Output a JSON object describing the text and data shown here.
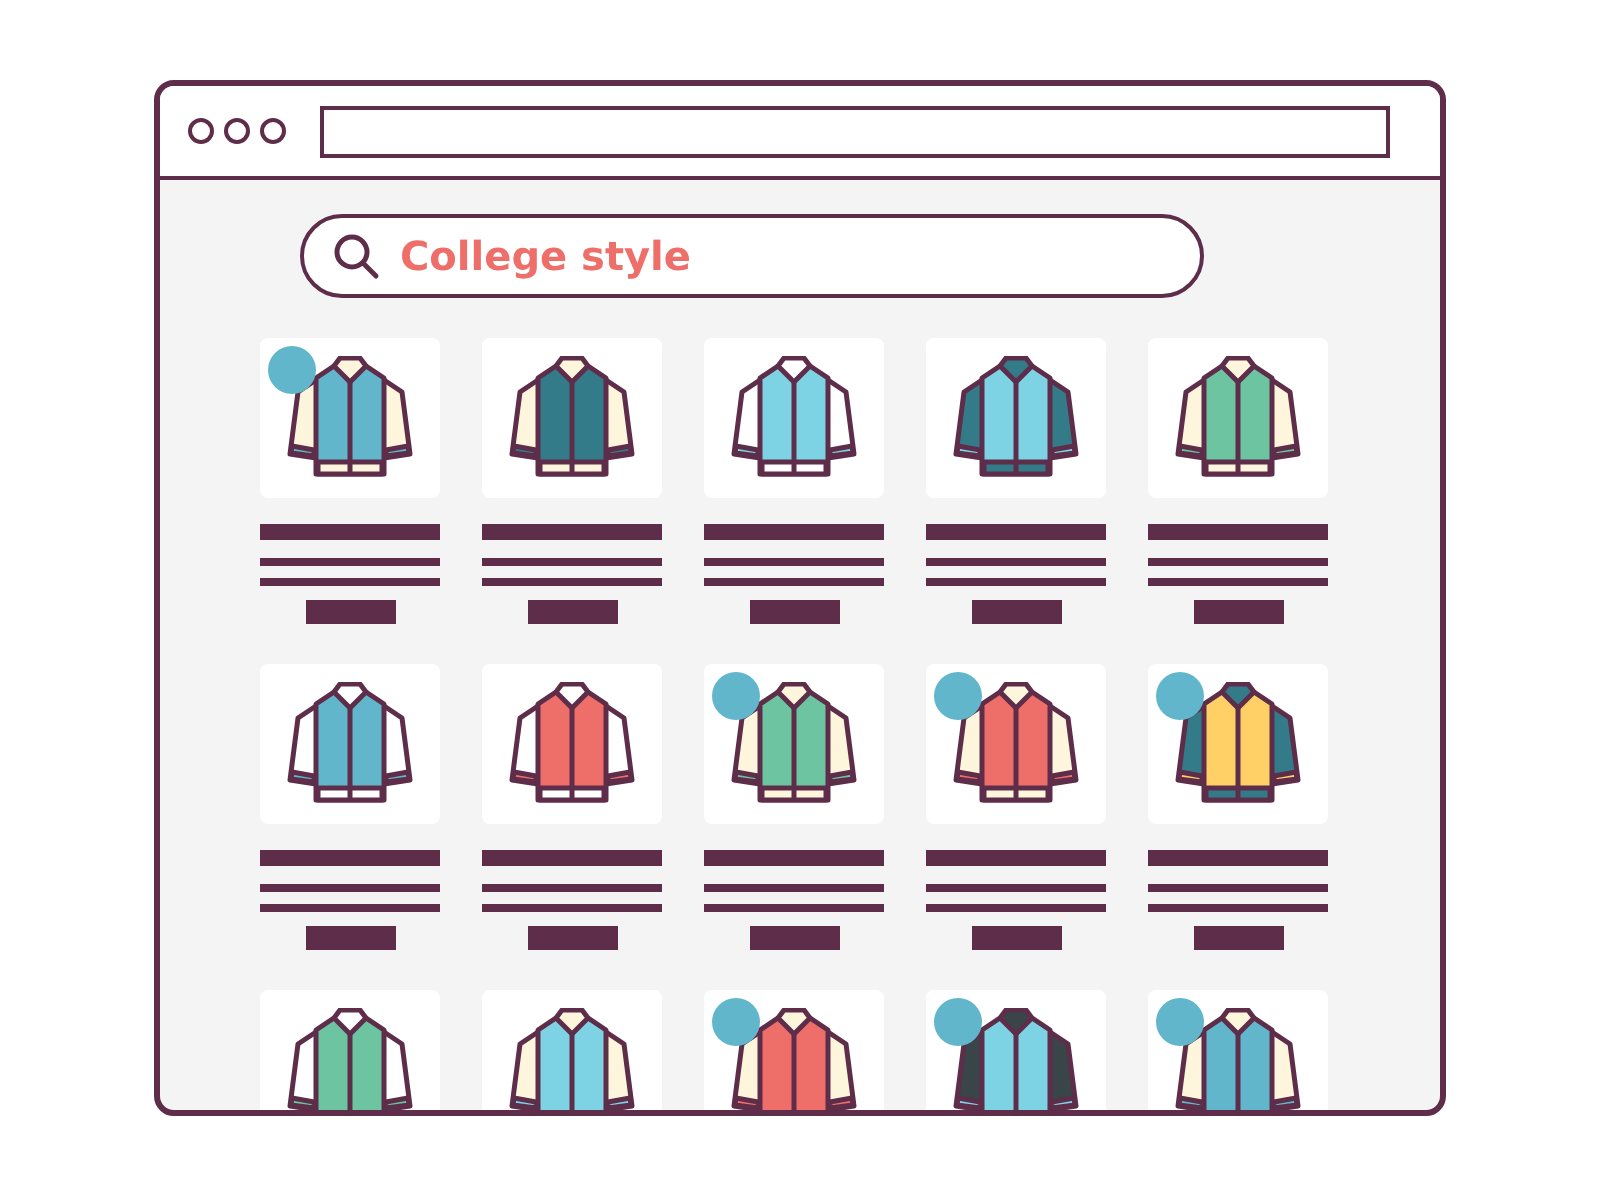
{
  "search": {
    "value": "College style"
  },
  "products": [
    {
      "color": "#62b6cb",
      "kind": "cream",
      "badge": true
    },
    {
      "color": "#347b8a",
      "kind": "cream",
      "badge": false
    },
    {
      "color": "#7dd3e3",
      "kind": "white",
      "badge": false
    },
    {
      "color": "#7dd3e3",
      "kind": "teal",
      "badge": false
    },
    {
      "color": "#6cc5a0",
      "kind": "cream",
      "badge": false
    },
    {
      "color": "#62b6cb",
      "kind": "white",
      "badge": false
    },
    {
      "color": "#ee6f69",
      "kind": "white",
      "badge": false
    },
    {
      "color": "#6cc5a0",
      "kind": "cream",
      "badge": true
    },
    {
      "color": "#ee6f69",
      "kind": "cream",
      "badge": true
    },
    {
      "color": "#fed065",
      "kind": "teal",
      "badge": true
    },
    {
      "color": "#6cc5a0",
      "kind": "white",
      "badge": false
    },
    {
      "color": "#7dd3e3",
      "kind": "cream",
      "badge": false
    },
    {
      "color": "#ee6f69",
      "kind": "cream",
      "badge": true
    },
    {
      "color": "#7dd3e3",
      "kind": "dark",
      "badge": true
    },
    {
      "color": "#62b6cb",
      "kind": "cream",
      "badge": true
    }
  ]
}
